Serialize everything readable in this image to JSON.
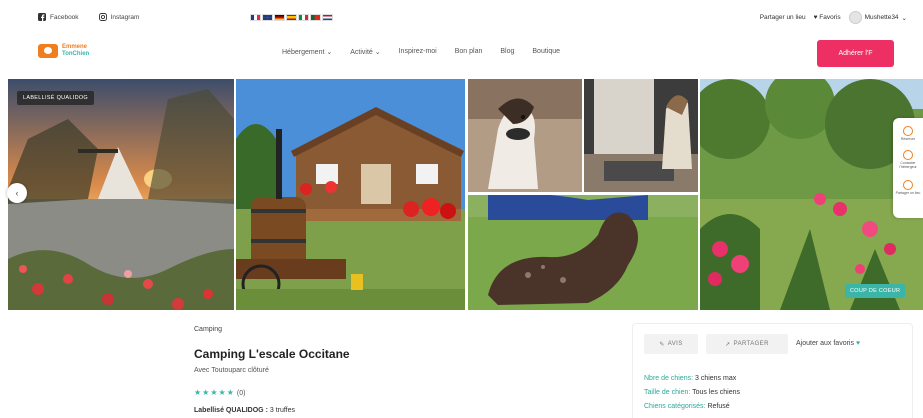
{
  "topbar": {
    "social": [
      {
        "icon": "facebook-icon",
        "label": "Facebook"
      },
      {
        "icon": "instagram-icon",
        "label": "Instagram"
      }
    ],
    "languages": [
      "fr",
      "en",
      "de",
      "es",
      "it",
      "pt",
      "nl"
    ],
    "partager": "Partager un lieu",
    "favoris": "Favoris",
    "user": "Mushette34"
  },
  "nav": {
    "logo_line1": "Emmene",
    "logo_line2": "TonChien",
    "items": [
      "Hébergement",
      "Activité",
      "Inspirez-moi",
      "Bon plan",
      "Blog",
      "Boutique"
    ],
    "cta": "Adhérer l'F"
  },
  "gallery": {
    "badge_left": "LABELLISÉ QUALIDOG",
    "badge_right": "COUP DE COEUR",
    "side_actions": [
      "Réserver",
      "Contacter l'hébergeur",
      "Partager un lieu"
    ]
  },
  "listing": {
    "category": "Camping",
    "title": "Camping L'escale Occitane",
    "subtitle": "Avec Toutouparc clôturé",
    "stars": "★★★★★",
    "rating_count": "(0)",
    "labellise_label": "Labellisé QUALIDOG :",
    "labellise_value": "3 truffes"
  },
  "side": {
    "avis": "AVIS",
    "partager": "PARTAGER",
    "favoris": "Ajouter aux favoris",
    "info": [
      {
        "k": "Nbre de chiens:",
        "v": "3 chiens max"
      },
      {
        "k": "Taille de chien:",
        "v": "Tous les chiens"
      },
      {
        "k": "Chiens catégorisés:",
        "v": "Refusé"
      }
    ]
  },
  "colors": {
    "accent": "#3ab5a8",
    "brand": "#f07e1f",
    "cta": "#ee2f63"
  }
}
